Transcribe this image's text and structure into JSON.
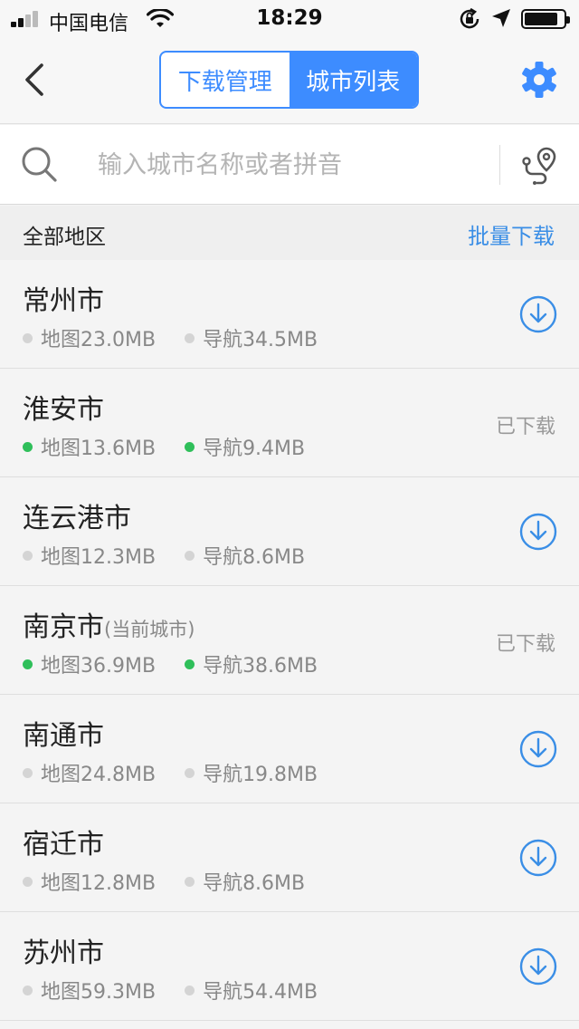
{
  "status_bar": {
    "carrier": "中国电信",
    "time": "18:29"
  },
  "nav": {
    "tabs": [
      {
        "label": "下载管理",
        "active": false
      },
      {
        "label": "城市列表",
        "active": true
      }
    ],
    "accent_color": "#3d8cff"
  },
  "search": {
    "placeholder": "输入城市名称或者拼音",
    "value": ""
  },
  "section": {
    "title": "全部地区",
    "batch_label": "批量下载"
  },
  "cities": [
    {
      "name": "常州市",
      "note": "",
      "map": "地图23.0MB",
      "nav": "导航34.5MB",
      "downloaded": false,
      "status": ""
    },
    {
      "name": "淮安市",
      "note": "",
      "map": "地图13.6MB",
      "nav": "导航9.4MB",
      "downloaded": true,
      "status": "已下载"
    },
    {
      "name": "连云港市",
      "note": "",
      "map": "地图12.3MB",
      "nav": "导航8.6MB",
      "downloaded": false,
      "status": ""
    },
    {
      "name": "南京市",
      "note": "(当前城市)",
      "map": "地图36.9MB",
      "nav": "导航38.6MB",
      "downloaded": true,
      "status": "已下载"
    },
    {
      "name": "南通市",
      "note": "",
      "map": "地图24.8MB",
      "nav": "导航19.8MB",
      "downloaded": false,
      "status": ""
    },
    {
      "name": "宿迁市",
      "note": "",
      "map": "地图12.8MB",
      "nav": "导航8.6MB",
      "downloaded": false,
      "status": ""
    },
    {
      "name": "苏州市",
      "note": "",
      "map": "地图59.3MB",
      "nav": "导航54.4MB",
      "downloaded": false,
      "status": ""
    }
  ]
}
